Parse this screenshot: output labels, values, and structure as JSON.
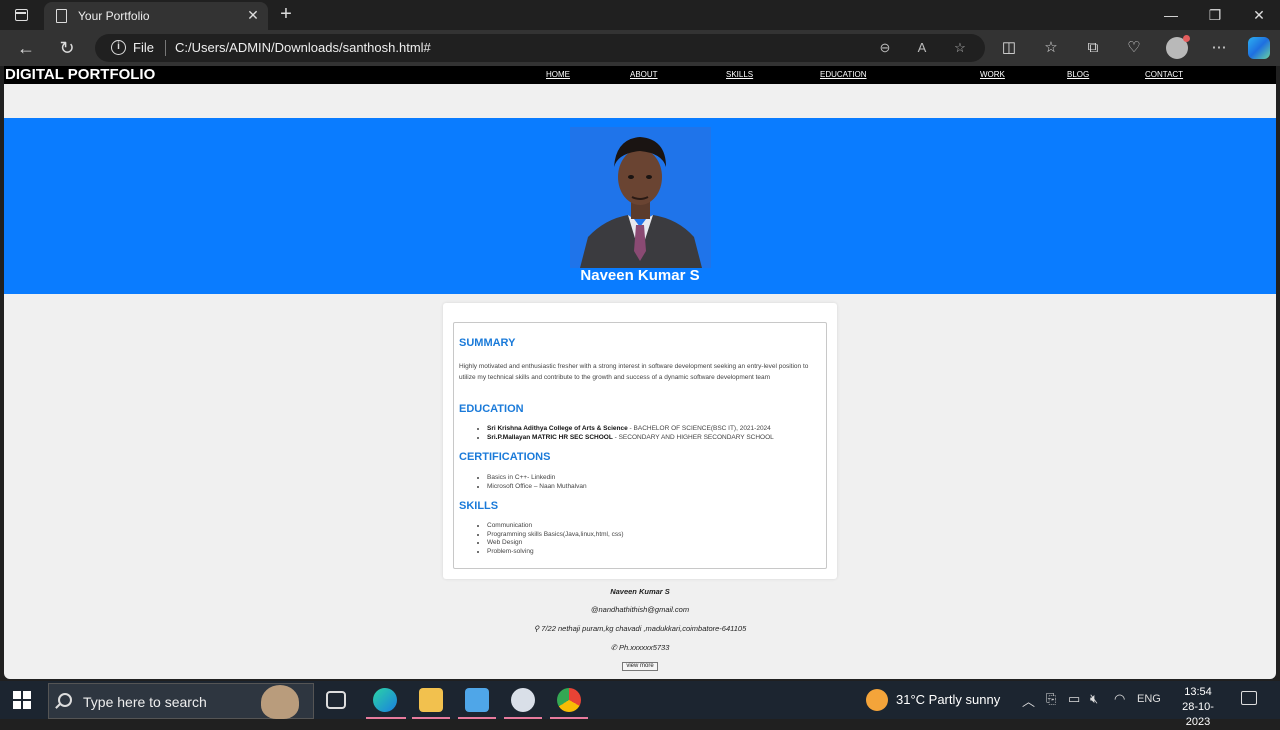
{
  "browser": {
    "tab_title": "Your Portfolio",
    "tab_close": "✕",
    "new_tab": "+",
    "address_scheme": "File",
    "address_url": "C:/Users/ADMIN/Downloads/santhosh.html#",
    "win_minimize": "—",
    "win_restore": "❐",
    "win_close": "✕"
  },
  "site": {
    "brand": "DIGITAL PORTFOLIO",
    "nav": [
      "HOME",
      "ABOUT",
      "SKILLS",
      "EDUCATION",
      "WORK",
      "BLOG",
      "CONTACT"
    ],
    "name": "Naveen Kumar S",
    "summary_title": "SUMMARY",
    "summary_text": "Highly motivated and enthusiastic fresher with a strong interest in software development seeking an entry-level position to utilize my technical skills and contribute to the growth and success of a dynamic software development team",
    "education_title": "EDUCATION",
    "education": [
      {
        "school": "Sri Krishna Adithya College of Arts & Science",
        "detail": " - BACHELOR OF SCIENCE(BSC IT), 2021-2024"
      },
      {
        "school": "Sri.P.Mallayan MATRIC HR SEC SCHOOL",
        "detail": " - SECONDARY AND HIGHER SECONDARY SCHOOL"
      }
    ],
    "certifications_title": "CERTIFICATIONS",
    "certifications": [
      "Basics in C++- Linkedin",
      "Microsoft Office – Naan Muthalvan"
    ],
    "skills_title": "SKILLS",
    "skills": [
      "Communication",
      "Programming skills Basics(Java,linux,html, css)",
      "Web Design",
      "Problem-solving"
    ],
    "footer_name": "Naveen Kumar S",
    "footer_email": "@nandhathithish@gmail.com",
    "footer_address": "⚲ 7/22 nethaji puram,kg chavadi ,madukkari,coimbatore-641105",
    "footer_phone": "✆ Ph.xxxxxx5733",
    "view_more": "view more"
  },
  "taskbar": {
    "search_placeholder": "Type here to search",
    "weather": "31°C  Partly sunny",
    "language": "ENG",
    "time": "13:54",
    "date": "28-10-2023"
  }
}
